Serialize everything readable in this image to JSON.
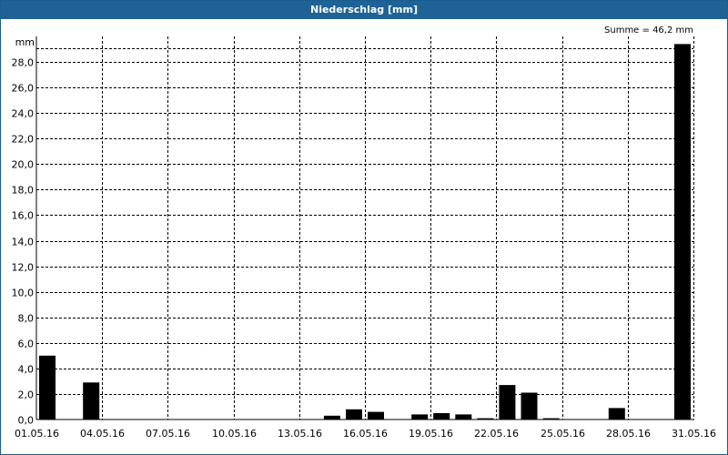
{
  "window": {
    "title": "Niederschlag [mm]"
  },
  "chart_data": {
    "type": "bar",
    "title": "Niederschlag [mm]",
    "unit_label": "mm",
    "summary": "Summe = 46,2 mm",
    "ylim": [
      0,
      30
    ],
    "y_ticks": [
      "0,0",
      "2,0",
      "4,0",
      "6,0",
      "8,0",
      "10,0",
      "12,0",
      "14,0",
      "16,0",
      "18,0",
      "20,0",
      "22,0",
      "24,0",
      "26,0",
      "28,0"
    ],
    "x_ticks": [
      "01.05.16",
      "04.05.16",
      "07.05.16",
      "10.05.16",
      "13.05.16",
      "16.05.16",
      "19.05.16",
      "22.05.16",
      "25.05.16",
      "28.05.16",
      "31.05.16"
    ],
    "grid": true,
    "bar_color": "#000000",
    "categories": [
      "01.05.16",
      "02.05.16",
      "03.05.16",
      "04.05.16",
      "05.05.16",
      "06.05.16",
      "07.05.16",
      "08.05.16",
      "09.05.16",
      "10.05.16",
      "11.05.16",
      "12.05.16",
      "13.05.16",
      "14.05.16",
      "15.05.16",
      "16.05.16",
      "17.05.16",
      "18.05.16",
      "19.05.16",
      "20.05.16",
      "21.05.16",
      "22.05.16",
      "23.05.16",
      "24.05.16",
      "25.05.16",
      "26.05.16",
      "27.05.16",
      "28.05.16",
      "29.05.16",
      "30.05.16",
      "31.05.16"
    ],
    "values": [
      5.0,
      0,
      2.9,
      0,
      0,
      0,
      0,
      0,
      0,
      0,
      0,
      0,
      0,
      0.3,
      0.8,
      0.6,
      0,
      0.4,
      0.5,
      0.4,
      0.1,
      2.7,
      2.1,
      0.1,
      0,
      0,
      0.9,
      0,
      0,
      29.4,
      0
    ]
  }
}
